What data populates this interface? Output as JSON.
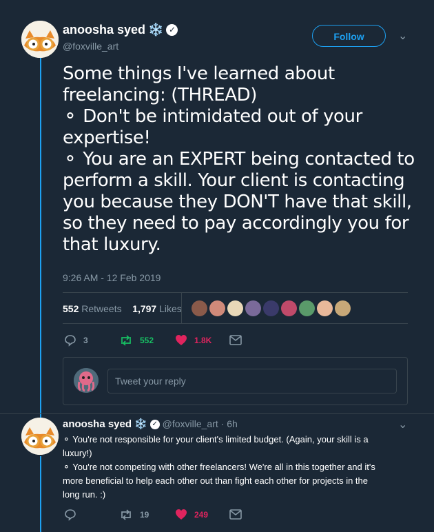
{
  "tweet": {
    "author_name": "anoosha syed",
    "author_emoji": "❄️",
    "author_handle": "@foxville_art",
    "follow_label": "Follow",
    "text_lines": [
      "Some things I've learned about",
      "freelancing: (THREAD)",
      "⚬ Don't be intimidated out of your",
      "expertise!",
      "⚬ You are an EXPERT being contacted to",
      "perform a skill. Your client is contacting",
      "you because they DON'T have that skill,",
      "so they need to pay accordingly you for",
      "that luxury."
    ],
    "timestamp": "9:26 AM - 12 Feb 2019",
    "retweets_count": "552",
    "retweets_label": "Retweets",
    "likes_count": "1,797",
    "likes_label": "Likes",
    "actions": {
      "replies": "3",
      "retweets": "552",
      "likes": "1.8K"
    }
  },
  "reply_box": {
    "placeholder": "Tweet your reply"
  },
  "reply_tweet": {
    "author_name": "anoosha syed",
    "author_emoji": "❄️",
    "author_handle": "@foxville_art",
    "time": "· 6h",
    "text_lines": [
      "⚬ You're not responsible for your client's limited budget. (Again, your skill is a",
      "luxury!)",
      "⚬ You're not competing with other freelancers! We're all in this together and it's",
      "more beneficial to help each other out than fight each other for projects in the",
      "long run. :)"
    ],
    "actions": {
      "replies": "",
      "retweets": "19",
      "likes": "249"
    }
  },
  "colors": {
    "background": "#1b2836",
    "accent": "#1da1f2",
    "retweet": "#17bf63",
    "like": "#e0245e",
    "muted": "#8899a6"
  }
}
